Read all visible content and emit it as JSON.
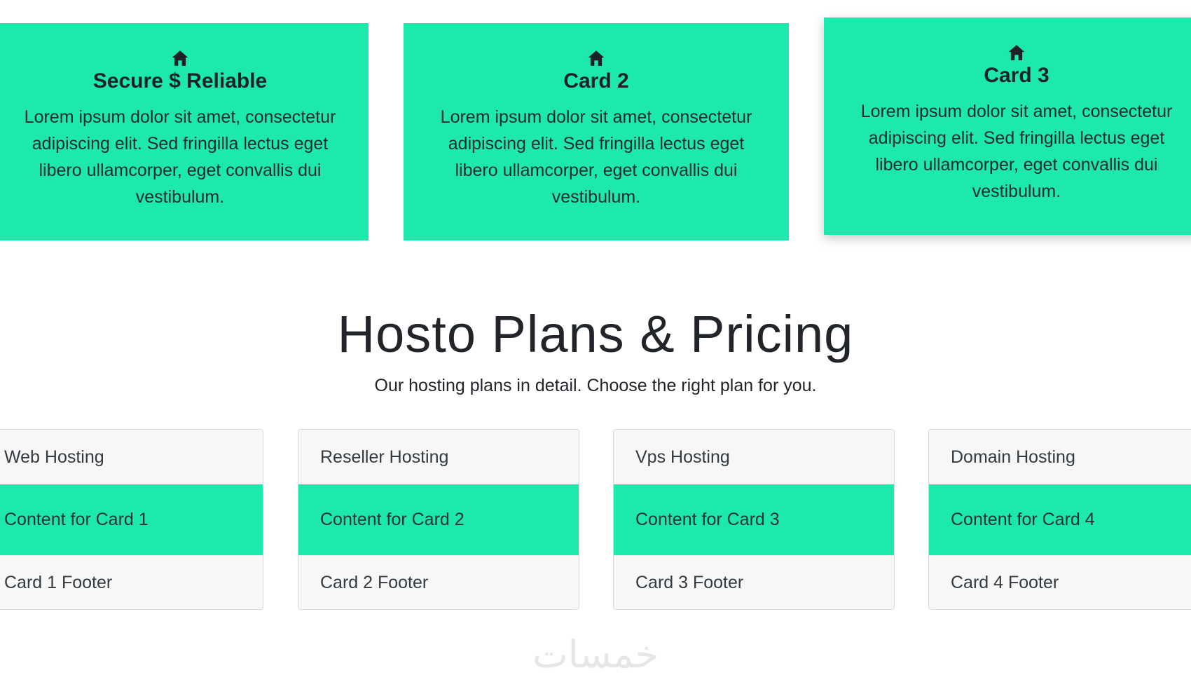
{
  "colors": {
    "accent": "#1de9ac",
    "text_dark": "#212529",
    "panel_bg": "#f7f7f7"
  },
  "features": [
    {
      "icon": "home-icon",
      "title": "Secure $ Reliable",
      "text": "Lorem ipsum dolor sit amet, consectetur adipiscing elit. Sed fringilla lectus eget libero ullamcorper, eget convallis dui vestibulum."
    },
    {
      "icon": "home-icon",
      "title": "Card 2",
      "text": "Lorem ipsum dolor sit amet, consectetur adipiscing elit. Sed fringilla lectus eget libero ullamcorper, eget convallis dui vestibulum."
    },
    {
      "icon": "home-icon",
      "title": "Card 3",
      "text": "Lorem ipsum dolor sit amet, consectetur adipiscing elit. Sed fringilla lectus eget libero ullamcorper, eget convallis dui vestibulum."
    }
  ],
  "pricing": {
    "title": "Hosto Plans & Pricing",
    "subtitle": "Our hosting plans in detail. Choose the right plan for you."
  },
  "plans": [
    {
      "header": "Web Hosting",
      "content": "Content for Card 1",
      "footer": "Card 1 Footer"
    },
    {
      "header": "Reseller Hosting",
      "content": "Content for Card 2",
      "footer": "Card 2 Footer"
    },
    {
      "header": "Vps Hosting",
      "content": "Content for Card 3",
      "footer": "Card 3 Footer"
    },
    {
      "header": "Domain Hosting",
      "content": "Content for Card 4",
      "footer": "Card 4 Footer"
    }
  ],
  "watermark": "خمسات"
}
